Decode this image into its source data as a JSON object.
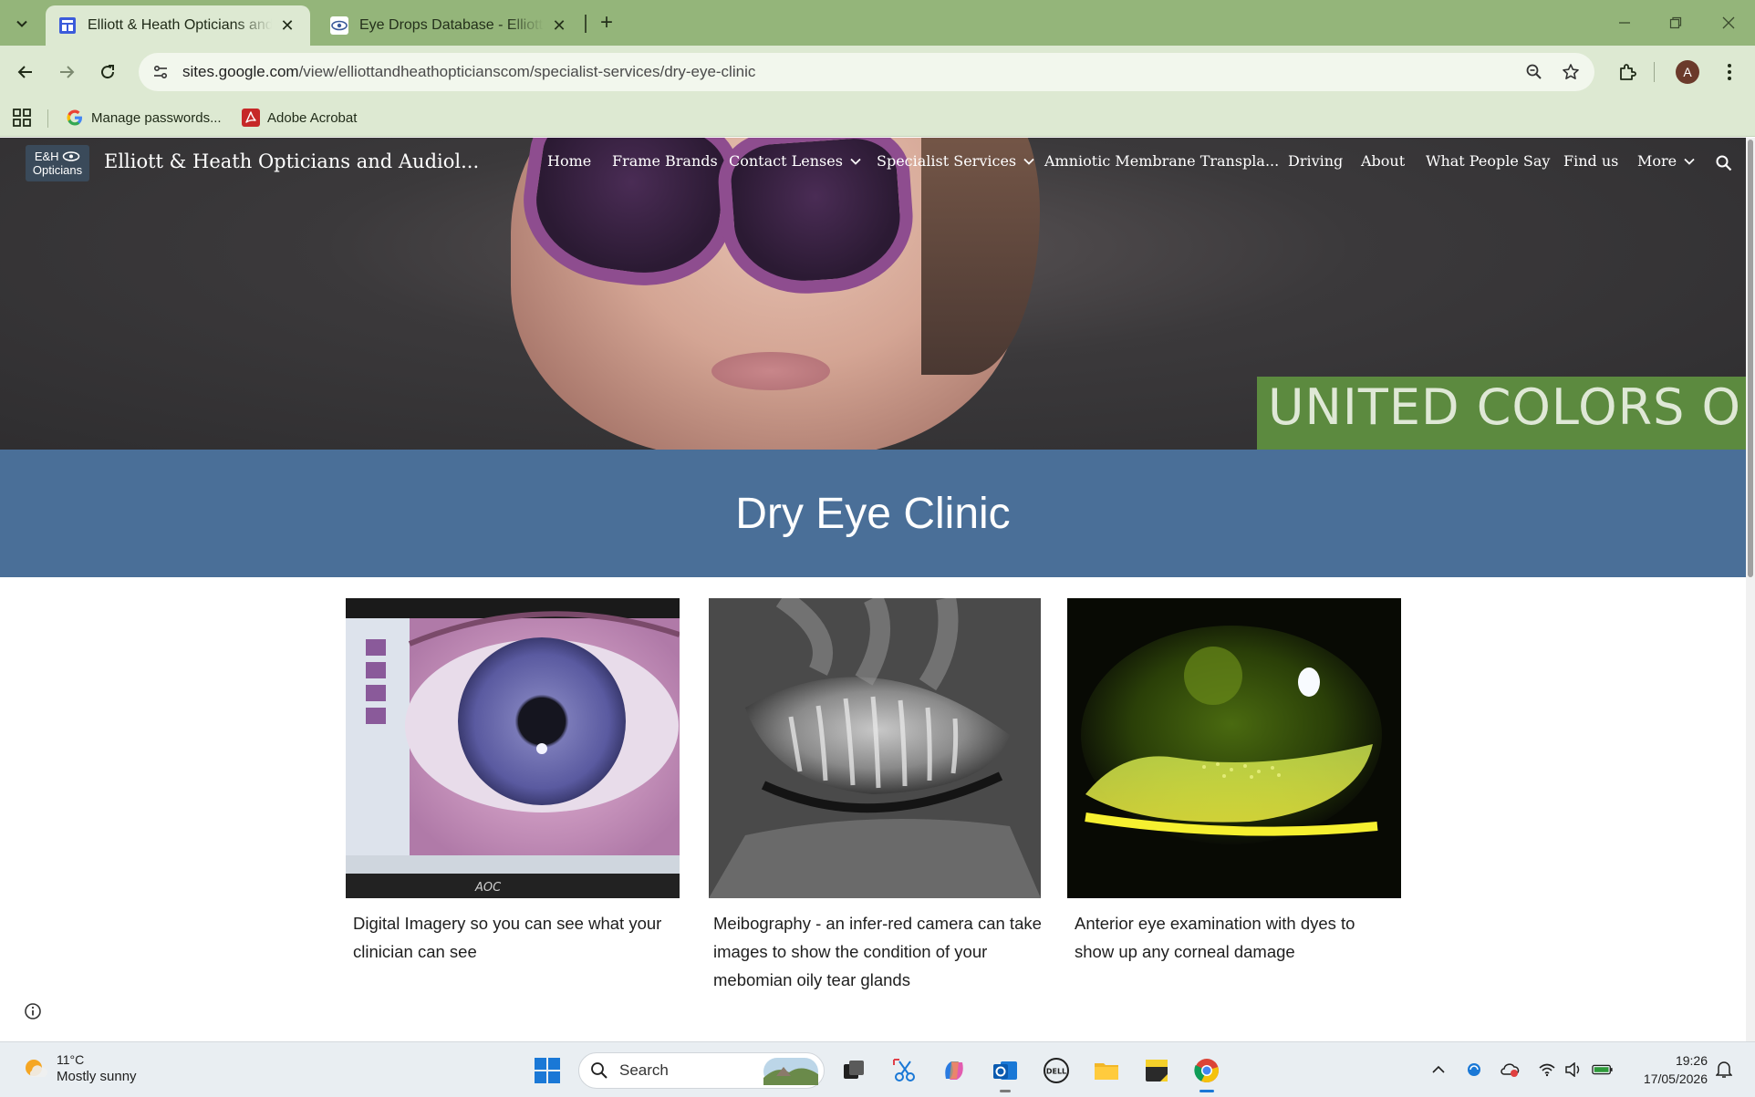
{
  "browser": {
    "tabs": [
      {
        "title": "Elliott & Heath Opticians and Audiologists",
        "active": true
      },
      {
        "title": "Eye Drops Database - Elliott and Heath",
        "active": false
      }
    ],
    "url_host": "sites.google.com",
    "url_path": "/view/elliottandheathopticianscom/specialist-services/dry-eye-clinic",
    "profile_initial": "A",
    "bookmarks": [
      {
        "label": "Manage passwords..."
      },
      {
        "label": "Adobe Acrobat"
      }
    ]
  },
  "site": {
    "logo_line1": "E&H",
    "logo_line2": "Opticians",
    "title": "Elliott & Heath Opticians and Audiol...",
    "nav": [
      {
        "label": "Home"
      },
      {
        "label": "Frame Brands"
      },
      {
        "label": "Contact Lenses"
      },
      {
        "label": "Specialist Services"
      },
      {
        "label": "Amniotic Membrane Transpla..."
      },
      {
        "label": "Driving"
      },
      {
        "label": "About"
      },
      {
        "label": "What People Say"
      },
      {
        "label": "Find us"
      },
      {
        "label": "More"
      }
    ],
    "hero_brand_text": "UNITED COLORS OF BENETTON"
  },
  "page": {
    "heading": "Dry Eye Clinic",
    "captions": [
      "Digital Imagery so you can see what your clinician can see",
      "Meibography - an infer-red camera can take images to show the condition of your mebomian oily tear glands",
      "Anterior eye examination with dyes to show up any corneal damage"
    ],
    "monitor_brand": "AOC"
  },
  "taskbar": {
    "temperature": "11°C",
    "weather": "Mostly sunny",
    "search_placeholder": "Search",
    "time": "19:26",
    "date": "17/05/2026"
  },
  "colors": {
    "browser_frame": "#94b57a",
    "toolbar": "#dde9d2",
    "title_band": "#4a6f98",
    "brand_panel": "#5c8a3f"
  }
}
